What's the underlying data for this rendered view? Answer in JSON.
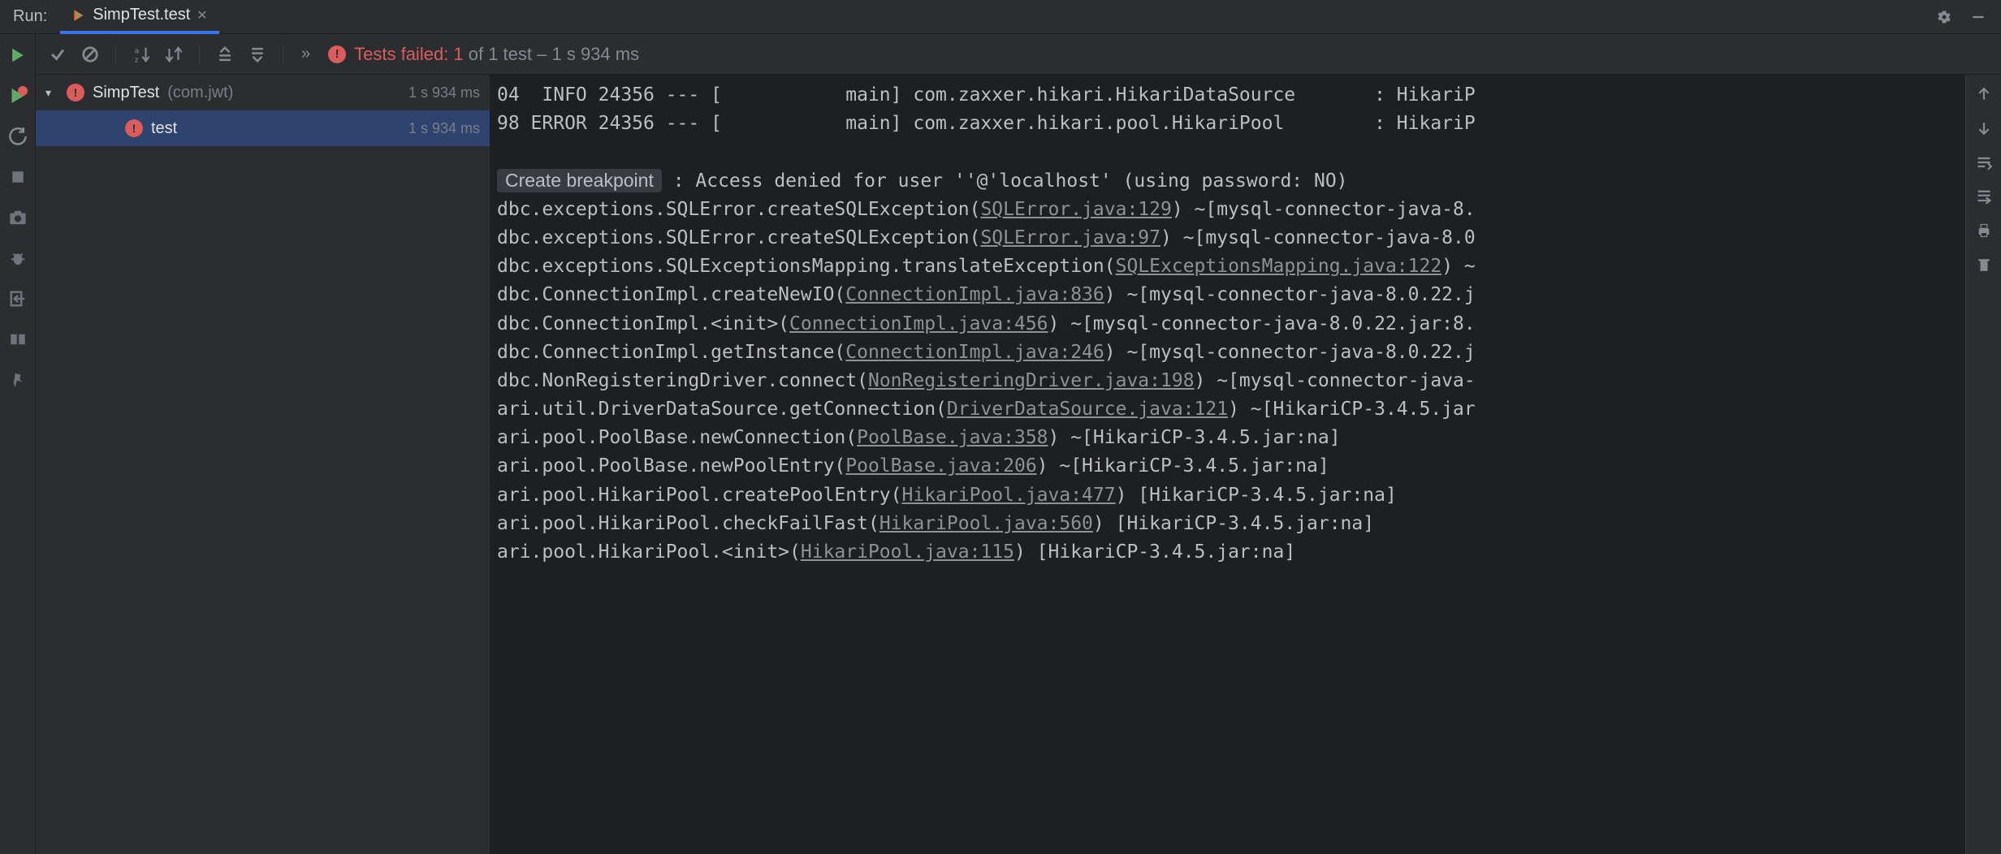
{
  "header": {
    "run_label": "Run:",
    "tab_name": "SimpTest.test"
  },
  "toolbar": {
    "status": {
      "fail_label": "Tests failed: 1",
      "rest": " of 1 test – 1 s 934 ms"
    }
  },
  "tree": {
    "root": {
      "name": "SimpTest",
      "pkg": "(com.jwt)",
      "time": "1 s 934 ms"
    },
    "child": {
      "name": "test",
      "time": "1 s 934 ms"
    }
  },
  "console": {
    "create_bp": "Create breakpoint",
    "lines": [
      {
        "pre": "04  INFO 24356 --- [           main] com.zaxxer.hikari.HikariDataSource       : HikariP",
        "link": "",
        "post": ""
      },
      {
        "pre": "98 ERROR 24356 --- [           main] com.zaxxer.hikari.pool.HikariPool        : HikariP",
        "link": "",
        "post": ""
      },
      {
        "pre": "",
        "link": "",
        "post": ""
      },
      {
        "pre": "__BP__ : Access denied for user ''@'localhost' (using password: NO)",
        "link": "",
        "post": ""
      },
      {
        "pre": "dbc.exceptions.SQLError.createSQLException(",
        "link": "SQLError.java:129",
        "post": ") ~[mysql-connector-java-8."
      },
      {
        "pre": "dbc.exceptions.SQLError.createSQLException(",
        "link": "SQLError.java:97",
        "post": ") ~[mysql-connector-java-8.0"
      },
      {
        "pre": "dbc.exceptions.SQLExceptionsMapping.translateException(",
        "link": "SQLExceptionsMapping.java:122",
        "post": ") ~"
      },
      {
        "pre": "dbc.ConnectionImpl.createNewIO(",
        "link": "ConnectionImpl.java:836",
        "post": ") ~[mysql-connector-java-8.0.22.j"
      },
      {
        "pre": "dbc.ConnectionImpl.<init>(",
        "link": "ConnectionImpl.java:456",
        "post": ") ~[mysql-connector-java-8.0.22.jar:8."
      },
      {
        "pre": "dbc.ConnectionImpl.getInstance(",
        "link": "ConnectionImpl.java:246",
        "post": ") ~[mysql-connector-java-8.0.22.j"
      },
      {
        "pre": "dbc.NonRegisteringDriver.connect(",
        "link": "NonRegisteringDriver.java:198",
        "post": ") ~[mysql-connector-java-"
      },
      {
        "pre": "ari.util.DriverDataSource.getConnection(",
        "link": "DriverDataSource.java:121",
        "post": ") ~[HikariCP-3.4.5.jar"
      },
      {
        "pre": "ari.pool.PoolBase.newConnection(",
        "link": "PoolBase.java:358",
        "post": ") ~[HikariCP-3.4.5.jar:na]"
      },
      {
        "pre": "ari.pool.PoolBase.newPoolEntry(",
        "link": "PoolBase.java:206",
        "post": ") ~[HikariCP-3.4.5.jar:na]"
      },
      {
        "pre": "ari.pool.HikariPool.createPoolEntry(",
        "link": "HikariPool.java:477",
        "post": ") [HikariCP-3.4.5.jar:na]"
      },
      {
        "pre": "ari.pool.HikariPool.checkFailFast(",
        "link": "HikariPool.java:560",
        "post": ") [HikariCP-3.4.5.jar:na]"
      },
      {
        "pre": "ari.pool.HikariPool.<init>(",
        "link": "HikariPool.java:115",
        "post": ") [HikariCP-3.4.5.jar:na]"
      }
    ]
  }
}
